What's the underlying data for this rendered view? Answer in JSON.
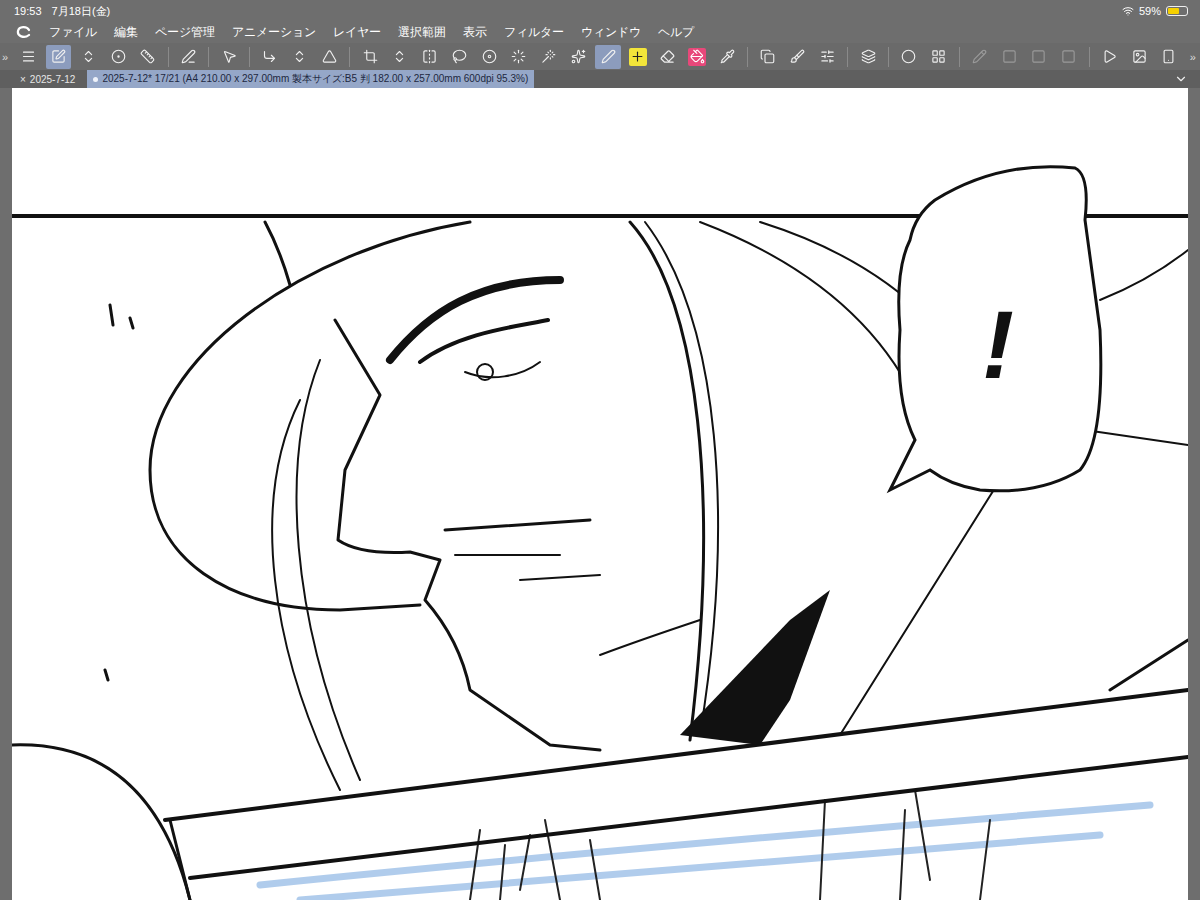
{
  "status_bar": {
    "time": "19:53",
    "date": "7月18日(金)",
    "battery": "59%",
    "battery_level": 0.59,
    "charging": true
  },
  "menu_bar": {
    "items": [
      "ファイル",
      "編集",
      "ページ管理",
      "アニメーション",
      "レイヤー",
      "選択範囲",
      "表示",
      "フィルター",
      "ウィンドウ",
      "ヘルプ"
    ]
  },
  "panel_toggles": {
    "left": "»",
    "right": "»"
  },
  "toolbar": {
    "items": [
      {
        "selected": false,
        "disabled": false
      },
      {
        "selected": true,
        "disabled": false
      },
      {
        "selected": false,
        "disabled": false
      },
      {
        "selected": false,
        "disabled": false
      },
      {
        "selected": false,
        "disabled": false
      },
      {
        "selected": false,
        "disabled": false
      },
      {
        "selected": false,
        "disabled": false
      },
      {
        "selected": false,
        "disabled": false
      },
      {
        "selected": false,
        "disabled": false
      },
      {
        "selected": false,
        "disabled": false
      },
      {
        "selected": false,
        "disabled": false
      },
      {
        "selected": false,
        "disabled": false
      },
      {
        "selected": false,
        "disabled": false
      },
      {
        "selected": false,
        "disabled": false
      },
      {
        "selected": false,
        "disabled": false
      },
      {
        "selected": false,
        "disabled": false
      },
      {
        "selected": false,
        "disabled": false
      },
      {
        "selected": false,
        "disabled": false
      },
      {
        "selected": true,
        "disabled": false
      },
      {
        "selected": false,
        "disabled": false
      },
      {
        "selected": false,
        "disabled": false
      },
      {
        "selected": false,
        "disabled": false
      },
      {
        "selected": false,
        "disabled": false
      },
      {
        "selected": false,
        "disabled": false
      },
      {
        "selected": false,
        "disabled": false
      },
      {
        "selected": false,
        "disabled": false
      },
      {
        "selected": false,
        "disabled": false
      },
      {
        "selected": false,
        "disabled": false
      },
      {
        "selected": false,
        "disabled": false
      },
      {
        "selected": false,
        "disabled": true
      },
      {
        "selected": false,
        "disabled": true
      },
      {
        "selected": false,
        "disabled": true
      },
      {
        "selected": false,
        "disabled": true
      },
      {
        "selected": false,
        "disabled": false
      },
      {
        "selected": false,
        "disabled": false
      },
      {
        "selected": false,
        "disabled": false
      }
    ]
  },
  "tabs": [
    {
      "label": "2025-7-12",
      "close": "×",
      "selected": false,
      "modified": false
    },
    {
      "label": "2025-7-12* 17/21 (A4 210.00 x 297.00mm 製本サイズ:B5 判 182.00 x 257.00mm 600dpi 95.3%)",
      "close": "",
      "selected": true,
      "modified": true
    }
  ],
  "canvas": {
    "speech_bubble": "!"
  }
}
